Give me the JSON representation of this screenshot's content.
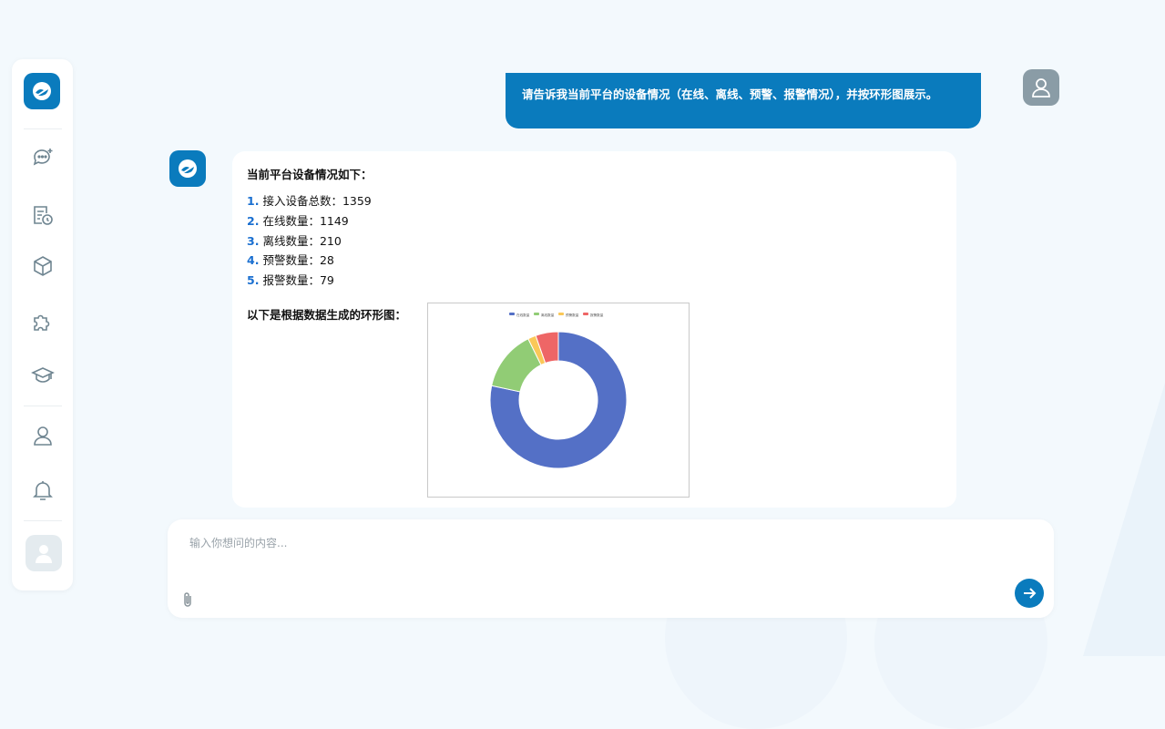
{
  "sidebar": {
    "icons": [
      "logo-icon",
      "new-chat-icon",
      "history-icon",
      "box-icon",
      "plugin-icon",
      "learning-icon",
      "profile-icon",
      "bell-icon",
      "avatar-icon"
    ]
  },
  "conversation": {
    "user_message": "请告诉我当前平台的设备情况（在线、离线、预警、报警情况），并按环形图展示。",
    "bot_title": "当前平台设备情况如下：",
    "stats": [
      {
        "num": "1.",
        "text": "接入设备总数：1359"
      },
      {
        "num": "2.",
        "text": "在线数量：1149"
      },
      {
        "num": "3.",
        "text": "离线数量：210"
      },
      {
        "num": "4.",
        "text": "预警数量：28"
      },
      {
        "num": "5.",
        "text": "报警数量：79"
      }
    ],
    "chart_intro": "以下是根据数据生成的环形图："
  },
  "chart_data": {
    "type": "pie",
    "donut": true,
    "categories": [
      "在线数量",
      "离线数量",
      "预警数量",
      "报警数量"
    ],
    "values": [
      1149,
      210,
      28,
      79
    ],
    "colors": [
      "#5470c6",
      "#91cc75",
      "#fac858",
      "#ee6666"
    ],
    "legend": "top-center"
  },
  "composer": {
    "placeholder": "输入你想问的内容..."
  },
  "colors": {
    "accent": "#0a7bbd",
    "background": "#f3f9fd"
  }
}
